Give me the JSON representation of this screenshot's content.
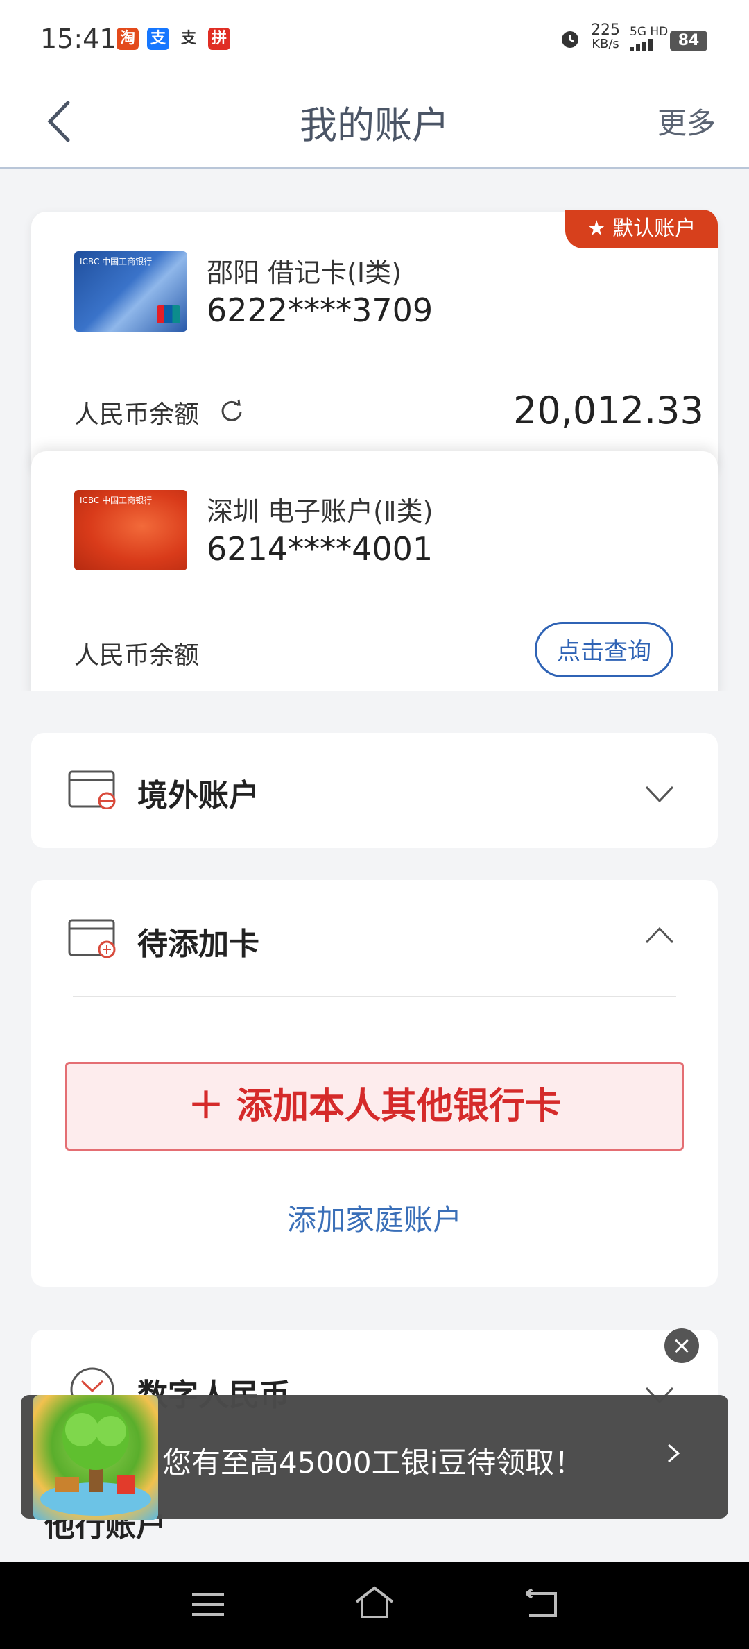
{
  "status_bar": {
    "time": "15:41",
    "apps": [
      "淘",
      "支",
      "支",
      "拼"
    ],
    "speed": "225",
    "speed_unit": "KB/s",
    "network": "5G HD",
    "battery": "84"
  },
  "header": {
    "title": "我的账户",
    "more_label": "更多"
  },
  "accounts": [
    {
      "name": "邵阳 借记卡(Ⅰ类)",
      "number": "6222****3709",
      "balance_label": "人民币余额",
      "balance": "20,012.33",
      "default_badge": "默认账户",
      "card_color": "#2b5fb2"
    },
    {
      "name": "深圳 电子账户(Ⅱ类)",
      "number": "6214****4001",
      "balance_label": "人民币余额",
      "query_label": "点击查询",
      "card_color": "#d93b1a"
    }
  ],
  "sections": {
    "overseas": "境外账户",
    "pending": "待添加卡",
    "add_bank_card": "＋ 添加本人其他银行卡",
    "add_family": "添加家庭账户",
    "digital_rmb": "数字人民币",
    "other": "他行账户"
  },
  "toast": {
    "text": "您有至高45000工银i豆待领取！"
  },
  "colors": {
    "accent_red": "#d7401c",
    "accent_blue": "#2f63b5"
  }
}
